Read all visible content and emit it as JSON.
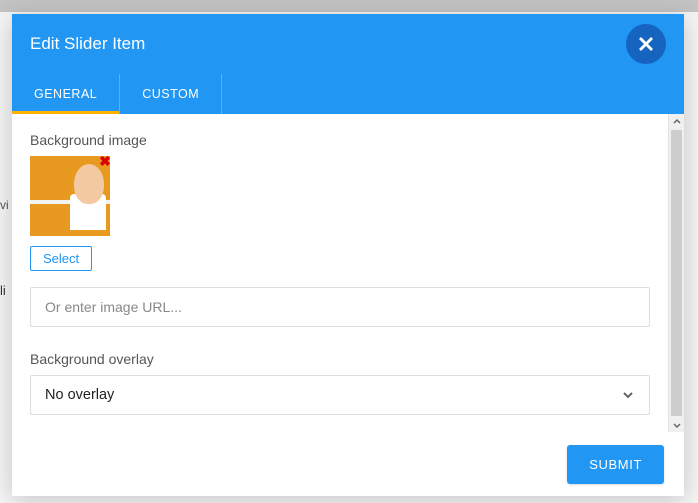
{
  "modal": {
    "title": "Edit Slider Item",
    "tabs": [
      {
        "label": "GENERAL",
        "active": true
      },
      {
        "label": "CUSTOM",
        "active": false
      }
    ],
    "bg_image": {
      "label": "Background image",
      "select_label": "Select",
      "url_placeholder": "Or enter image URL...",
      "url_value": ""
    },
    "bg_overlay": {
      "label": "Background overlay",
      "selected": "No overlay"
    },
    "submit_label": "SUBMIT"
  }
}
